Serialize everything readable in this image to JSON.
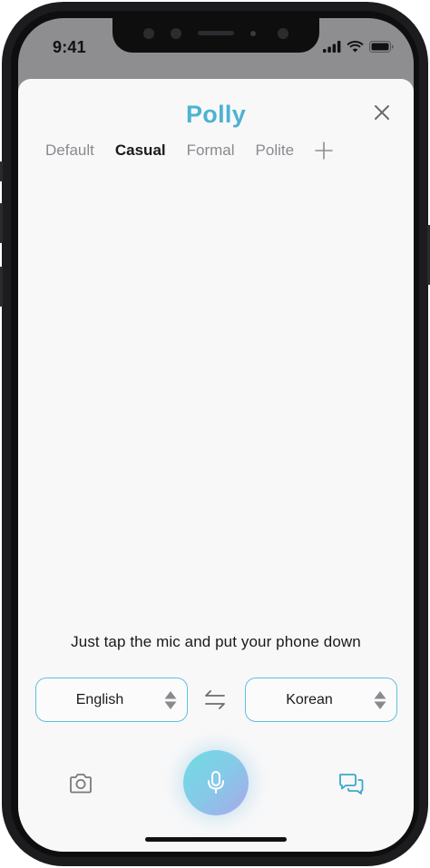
{
  "status_bar": {
    "time": "9:41",
    "icons": [
      "cellular-signal-icon",
      "wifi-icon",
      "battery-icon"
    ]
  },
  "app": {
    "title": "Polly",
    "accent_color": "#4cb3d1",
    "close_icon": "close-icon"
  },
  "tabs": {
    "items": [
      {
        "label": "Default",
        "active": false
      },
      {
        "label": "Casual",
        "active": true
      },
      {
        "label": "Formal",
        "active": false
      },
      {
        "label": "Polite",
        "active": false
      }
    ],
    "add_icon": "plus-icon"
  },
  "hint": {
    "text": "Just tap the mic and put your phone down"
  },
  "languages": {
    "source": "English",
    "target": "Korean",
    "swap_icon": "swap-arrows-icon",
    "border_color": "#5cc2d8"
  },
  "bottom_bar": {
    "camera_icon": "camera-icon",
    "mic_icon": "microphone-icon",
    "chat_icon": "chat-bubbles-icon"
  }
}
